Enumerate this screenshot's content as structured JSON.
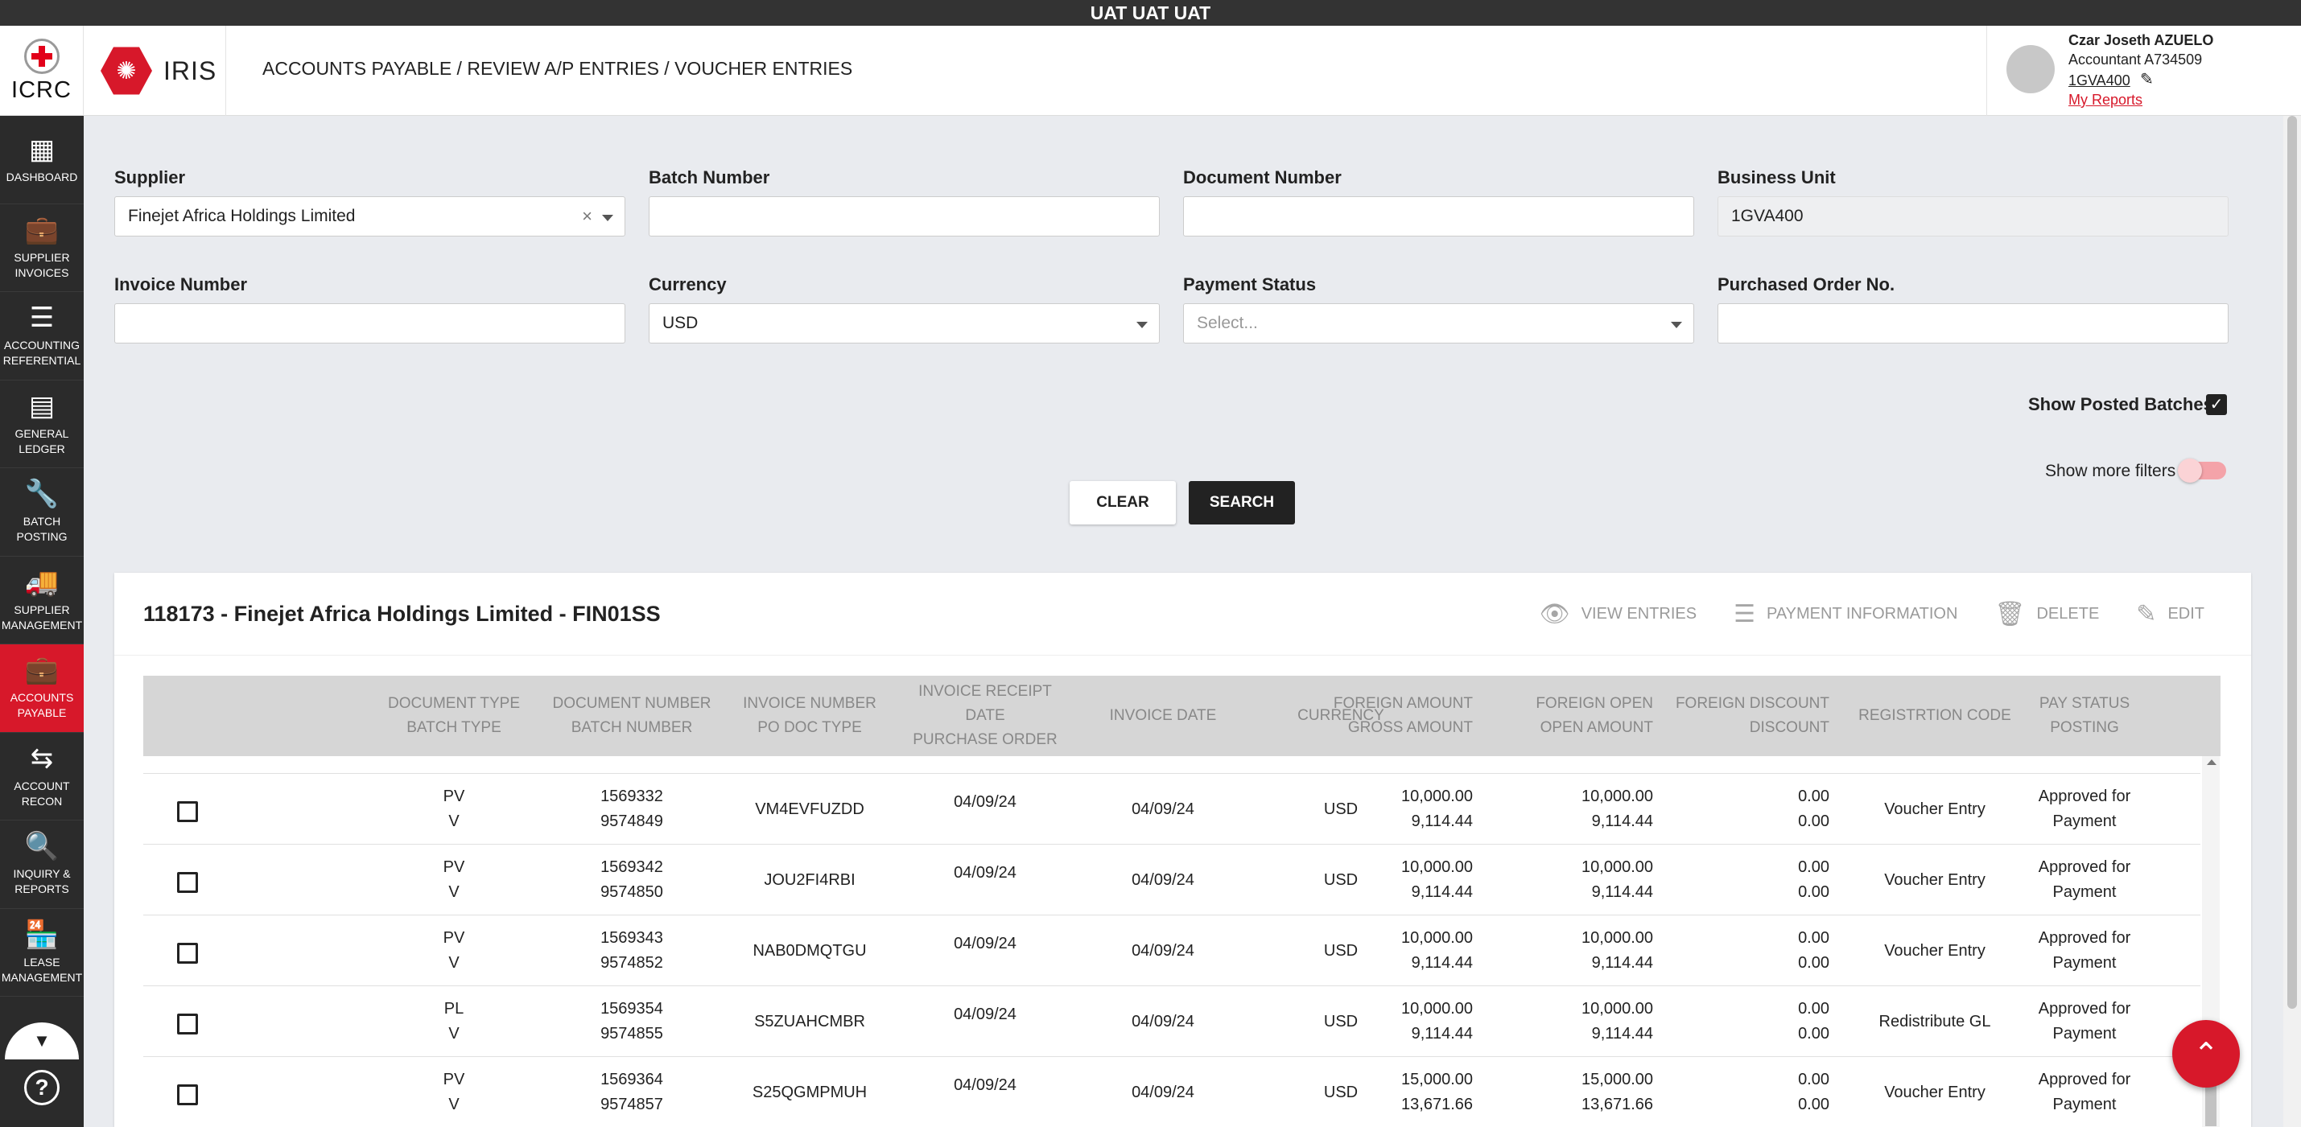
{
  "env_banner": "UAT UAT UAT",
  "header": {
    "org_logo_text": "ICRC",
    "app_name": "IRIS",
    "breadcrumb": "ACCOUNTS PAYABLE / REVIEW A/P ENTRIES / VOUCHER ENTRIES",
    "user": {
      "name": "Czar Joseth AZUELO",
      "role": "Accountant A734509",
      "business_unit": "1GVA400",
      "reports_link": "My Reports"
    }
  },
  "sidebar": {
    "items": [
      {
        "line1": "DASHBOARD",
        "line2": "",
        "icon": "dashboard-icon",
        "glyph": "▦"
      },
      {
        "line1": "SUPPLIER",
        "line2": "INVOICES",
        "icon": "briefcase-icon",
        "glyph": "💼"
      },
      {
        "line1": "ACCOUNTING",
        "line2": "REFERENTIAL",
        "icon": "storage-icon",
        "glyph": "☰"
      },
      {
        "line1": "GENERAL",
        "line2": "LEDGER",
        "icon": "ledger-icon",
        "glyph": "▤"
      },
      {
        "line1": "BATCH",
        "line2": "POSTING",
        "icon": "wrench-icon",
        "glyph": "🔧"
      },
      {
        "line1": "SUPPLIER",
        "line2": "MANAGEMENT",
        "icon": "truck-icon",
        "glyph": "🚚"
      },
      {
        "line1": "ACCOUNTS",
        "line2": "PAYABLE",
        "icon": "briefcase-icon",
        "glyph": "💼"
      },
      {
        "line1": "ACCOUNT",
        "line2": "RECON",
        "icon": "compare-arrows-icon",
        "glyph": "⇆"
      },
      {
        "line1": "INQUIRY &",
        "line2": "REPORTS",
        "icon": "search-report-icon",
        "glyph": "🔍"
      },
      {
        "line1": "LEASE",
        "line2": "MANAGEMENT",
        "icon": "store-icon",
        "glyph": "🏪"
      }
    ],
    "active_index": 6
  },
  "filters": {
    "supplier": {
      "label": "Supplier",
      "value": "Finejet Africa Holdings Limited"
    },
    "batch_number": {
      "label": "Batch Number",
      "value": ""
    },
    "document_number": {
      "label": "Document Number",
      "value": ""
    },
    "business_unit": {
      "label": "Business Unit",
      "value": "1GVA400"
    },
    "invoice_number": {
      "label": "Invoice Number",
      "value": ""
    },
    "currency": {
      "label": "Currency",
      "value": "USD"
    },
    "payment_status": {
      "label": "Payment Status",
      "placeholder": "Select..."
    },
    "purchased_order": {
      "label": "Purchased Order No.",
      "value": ""
    },
    "show_posted_batches": {
      "label": "Show Posted Batches",
      "checked": true
    },
    "show_more_filters": {
      "label": "Show more filters",
      "on": false
    },
    "clear_label": "CLEAR",
    "search_label": "SEARCH"
  },
  "results": {
    "title": "118173 - Finejet Africa Holdings Limited - FIN01SS",
    "actions": {
      "view_entries": "VIEW ENTRIES",
      "payment_information": "PAYMENT INFORMATION",
      "delete": "DELETE",
      "edit": "EDIT"
    },
    "columns": [
      {
        "l1": "DOCUMENT TYPE",
        "l2": "BATCH TYPE",
        "l3": ""
      },
      {
        "l1": "DOCUMENT NUMBER",
        "l2": "BATCH NUMBER",
        "l3": ""
      },
      {
        "l1": "INVOICE NUMBER",
        "l2": "PO DOC TYPE",
        "l3": ""
      },
      {
        "l1": "INVOICE RECEIPT",
        "l2": "DATE",
        "l3": "PURCHASE ORDER"
      },
      {
        "l1": "INVOICE DATE",
        "l2": "",
        "l3": ""
      },
      {
        "l1": "CURRENCY",
        "l2": "",
        "l3": ""
      },
      {
        "l1": "FOREIGN AMOUNT",
        "l2": "GROSS AMOUNT",
        "l3": ""
      },
      {
        "l1": "FOREIGN OPEN",
        "l2": "OPEN AMOUNT",
        "l3": ""
      },
      {
        "l1": "FOREIGN DISCOUNT",
        "l2": "DISCOUNT",
        "l3": ""
      },
      {
        "l1": "REGISTRTION CODE",
        "l2": "",
        "l3": ""
      },
      {
        "l1": "PAY STATUS",
        "l2": "POSTING",
        "l3": ""
      }
    ],
    "rows": [
      {
        "doc_type": "PV",
        "batch_type": "V",
        "doc_number": "1569332",
        "batch_number": "9574849",
        "invoice_number": "VM4EVFUZDD",
        "receipt_date": "04/09/24",
        "invoice_date": "04/09/24",
        "currency": "USD",
        "foreign_amount": "10,000.00",
        "gross_amount": "9,114.44",
        "foreign_open": "10,000.00",
        "open_amount": "9,114.44",
        "foreign_discount": "0.00",
        "discount": "0.00",
        "registration_code": "Voucher Entry",
        "pay_status_1": "Approved for",
        "pay_status_2": "Payment"
      },
      {
        "doc_type": "PV",
        "batch_type": "V",
        "doc_number": "1569342",
        "batch_number": "9574850",
        "invoice_number": "JOU2FI4RBI",
        "receipt_date": "04/09/24",
        "invoice_date": "04/09/24",
        "currency": "USD",
        "foreign_amount": "10,000.00",
        "gross_amount": "9,114.44",
        "foreign_open": "10,000.00",
        "open_amount": "9,114.44",
        "foreign_discount": "0.00",
        "discount": "0.00",
        "registration_code": "Voucher Entry",
        "pay_status_1": "Approved for",
        "pay_status_2": "Payment"
      },
      {
        "doc_type": "PV",
        "batch_type": "V",
        "doc_number": "1569343",
        "batch_number": "9574852",
        "invoice_number": "NAB0DMQTGU",
        "receipt_date": "04/09/24",
        "invoice_date": "04/09/24",
        "currency": "USD",
        "foreign_amount": "10,000.00",
        "gross_amount": "9,114.44",
        "foreign_open": "10,000.00",
        "open_amount": "9,114.44",
        "foreign_discount": "0.00",
        "discount": "0.00",
        "registration_code": "Voucher Entry",
        "pay_status_1": "Approved for",
        "pay_status_2": "Payment"
      },
      {
        "doc_type": "PL",
        "batch_type": "V",
        "doc_number": "1569354",
        "batch_number": "9574855",
        "invoice_number": "S5ZUAHCMBR",
        "receipt_date": "04/09/24",
        "invoice_date": "04/09/24",
        "currency": "USD",
        "foreign_amount": "10,000.00",
        "gross_amount": "9,114.44",
        "foreign_open": "10,000.00",
        "open_amount": "9,114.44",
        "foreign_discount": "0.00",
        "discount": "0.00",
        "registration_code": "Redistribute GL",
        "pay_status_1": "Approved for",
        "pay_status_2": "Payment"
      },
      {
        "doc_type": "PV",
        "batch_type": "V",
        "doc_number": "1569364",
        "batch_number": "9574857",
        "invoice_number": "S25QGMPMUH",
        "receipt_date": "04/09/24",
        "invoice_date": "04/09/24",
        "currency": "USD",
        "foreign_amount": "15,000.00",
        "gross_amount": "13,671.66",
        "foreign_open": "15,000.00",
        "open_amount": "13,671.66",
        "foreign_discount": "0.00",
        "discount": "0.00",
        "registration_code": "Voucher Entry",
        "pay_status_1": "Approved for",
        "pay_status_2": "Payment"
      }
    ]
  },
  "colors": {
    "brand_red": "#d7182a",
    "sidebar_bg": "#2b2b2b",
    "page_bg": "#e9ebef"
  }
}
